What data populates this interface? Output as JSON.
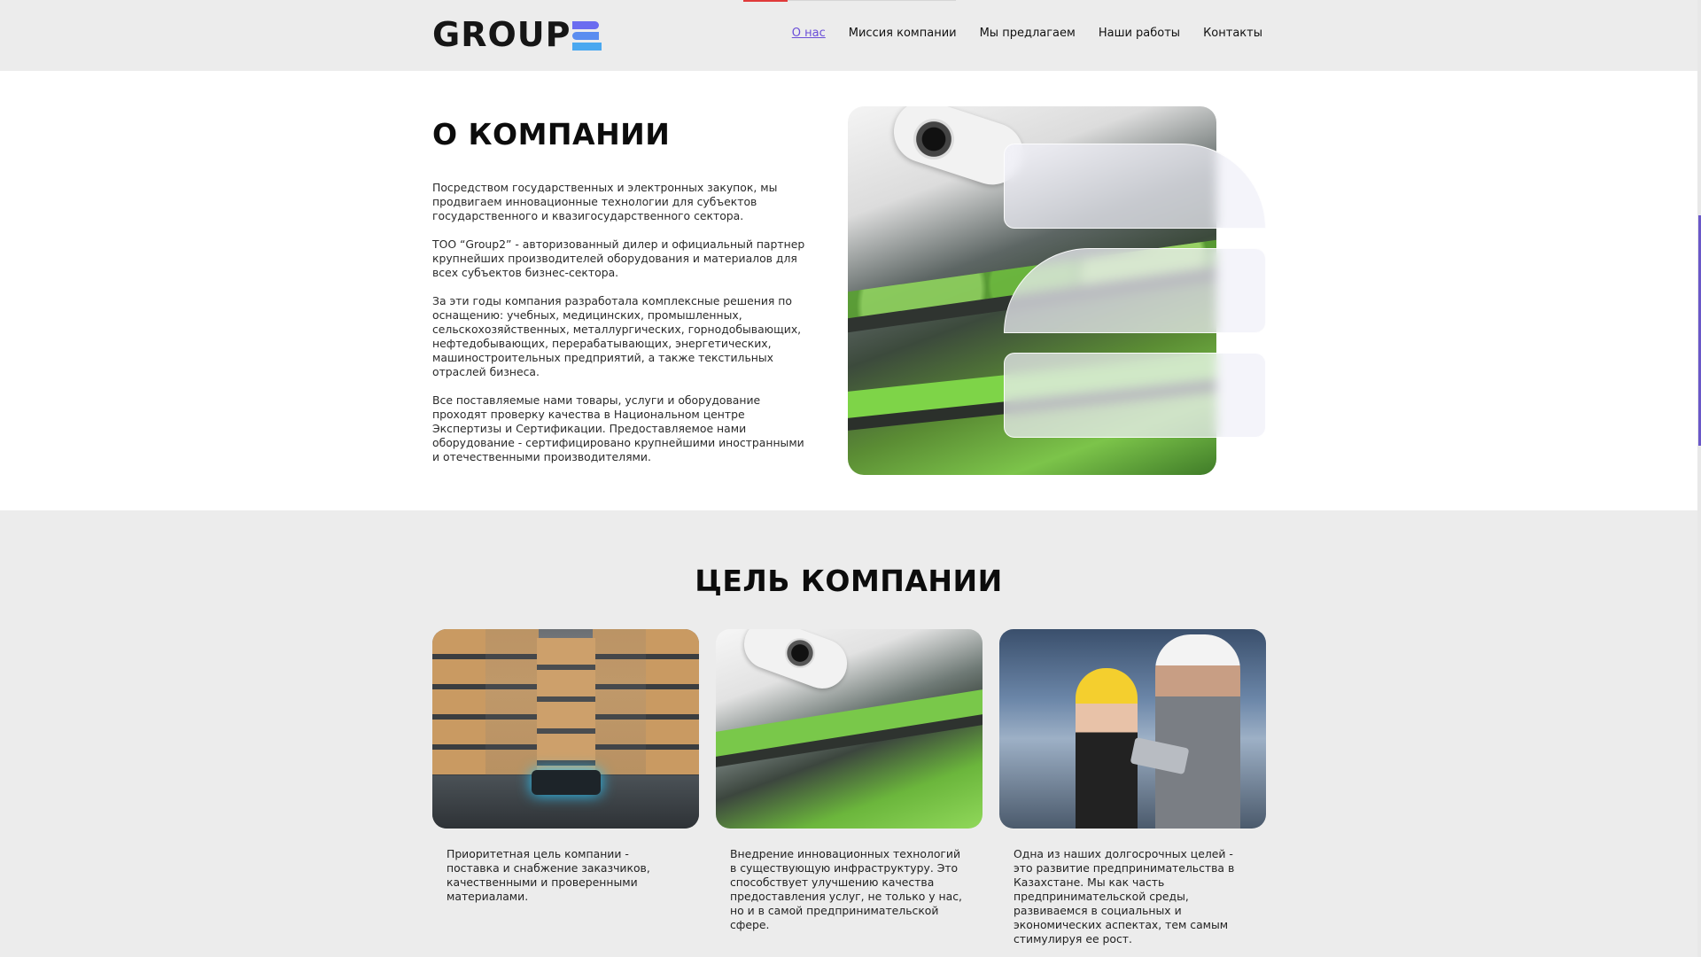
{
  "header": {
    "logo_text": "GROUP",
    "nav": [
      "О нас",
      "Миссия компании",
      "Мы предлагаем",
      "Наши работы",
      "Контакты"
    ],
    "active_index": 0,
    "accent_color": "#6a4ed8"
  },
  "about": {
    "title": "О КОМПАНИИ",
    "paragraphs": [
      "Посредством государственных и электронных закупок, мы продвигаем инновационные технологии для субъектов государственного и квазигосударственного сектора.",
      "ТОО “Group2” - авторизованный дилер и официальный партнер крупнейших производителей оборудования и материалов для всех субъектов бизнес-сектора.",
      "За эти годы компания разработала комплексные решения по оснащению: учебных, медицинских, промышленных, сельскохозяйственных, металлургических, горнодобывающих, нефтедобывающих, перерабатывающих, энергетических, машиностроительных предприятий, а также текстильных отраслей бизнеса.",
      "Все поставляемые нами товары, услуги и оборудование проходят проверку качества в Национальном центре Экспертизы и Сертификации. Предоставляемое нами оборудование - сертифицировано крупнейшими иностранными и отечественными производителями."
    ]
  },
  "goals": {
    "title": "ЦЕЛЬ КОМПАНИИ",
    "cards": [
      {
        "text": "Приоритетная цель компании - поставка и снабжение заказчиков, качественными и проверенными материалами."
      },
      {
        "text": "Внедрение инновационных технологий в существующую инфраструктуру. Это способствует улучшению качества предоставления услуг, не только у нас, но и в самой предпринимательской сфере."
      },
      {
        "text": "Одна из наших долгосрочных целей - это развитие предпринимательства в Казахстане. Мы как часть предпринимательской среды, развиваемся в социальных и экономических аспектах, тем самым стимулируя ее рост."
      }
    ]
  }
}
